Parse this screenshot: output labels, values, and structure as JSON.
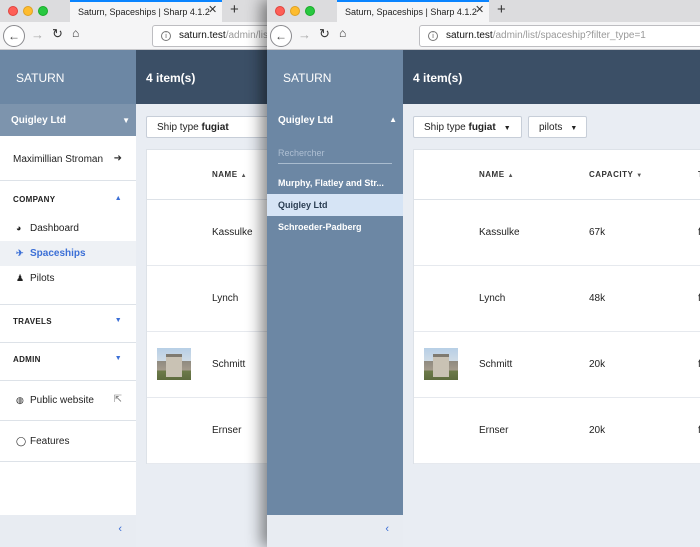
{
  "browser": {
    "tab_title": "Saturn, Spaceships | Sharp 4.1.2",
    "url_host": "saturn.test",
    "url_path_short": "/admin/list",
    "url_path_full": "/admin/list/spaceship?filter_type=1"
  },
  "app": {
    "brand": "SATURN",
    "item_count": "4 item(s)",
    "tenant": "Quigley Ltd",
    "user_name": "Maximillian Stroman",
    "sections": {
      "company": "COMPANY",
      "travels": "TRAVELS",
      "admin": "ADMIN"
    },
    "menu": {
      "dashboard": "Dashboard",
      "spaceships": "Spaceships",
      "pilots": "Pilots",
      "public_website": "Public website",
      "features": "Features"
    }
  },
  "filters": {
    "ship_type_label": "Ship type",
    "ship_type_value": "fugiat",
    "pilots_label": "pilots"
  },
  "table": {
    "columns": {
      "name": "NAME",
      "capacity": "CAPACITY",
      "type_partial": "T"
    },
    "rows": [
      {
        "name": "Kassulke",
        "capacity": "67k",
        "type_partial": "f"
      },
      {
        "name": "Lynch",
        "capacity": "48k",
        "type_partial": "f"
      },
      {
        "name": "Schmitt",
        "capacity": "20k",
        "type_partial": "f",
        "has_image": true
      },
      {
        "name": "Ernser",
        "capacity": "20k",
        "type_partial": "f"
      }
    ]
  },
  "tenant_dropdown": {
    "search_placeholder": "Rechercher",
    "options": [
      "Murphy, Flatley and Str...",
      "Quigley Ltd",
      "Schroeder-Padberg"
    ],
    "selected": "Quigley Ltd"
  },
  "colors": {
    "brand_bg": "#6c87a4",
    "topbar_bg": "#3b4f66",
    "accent": "#3b6fd6"
  },
  "icons": {
    "back": "arrow-left-icon",
    "forward": "arrow-right-icon",
    "reload": "reload-icon",
    "home": "home-icon",
    "logout": "logout-icon",
    "dashboard": "dashboard-icon",
    "spaceships": "plane-icon",
    "pilots": "user-icon",
    "public_website": "globe-icon",
    "external": "external-link-icon",
    "features": "speech-bubble-icon"
  }
}
